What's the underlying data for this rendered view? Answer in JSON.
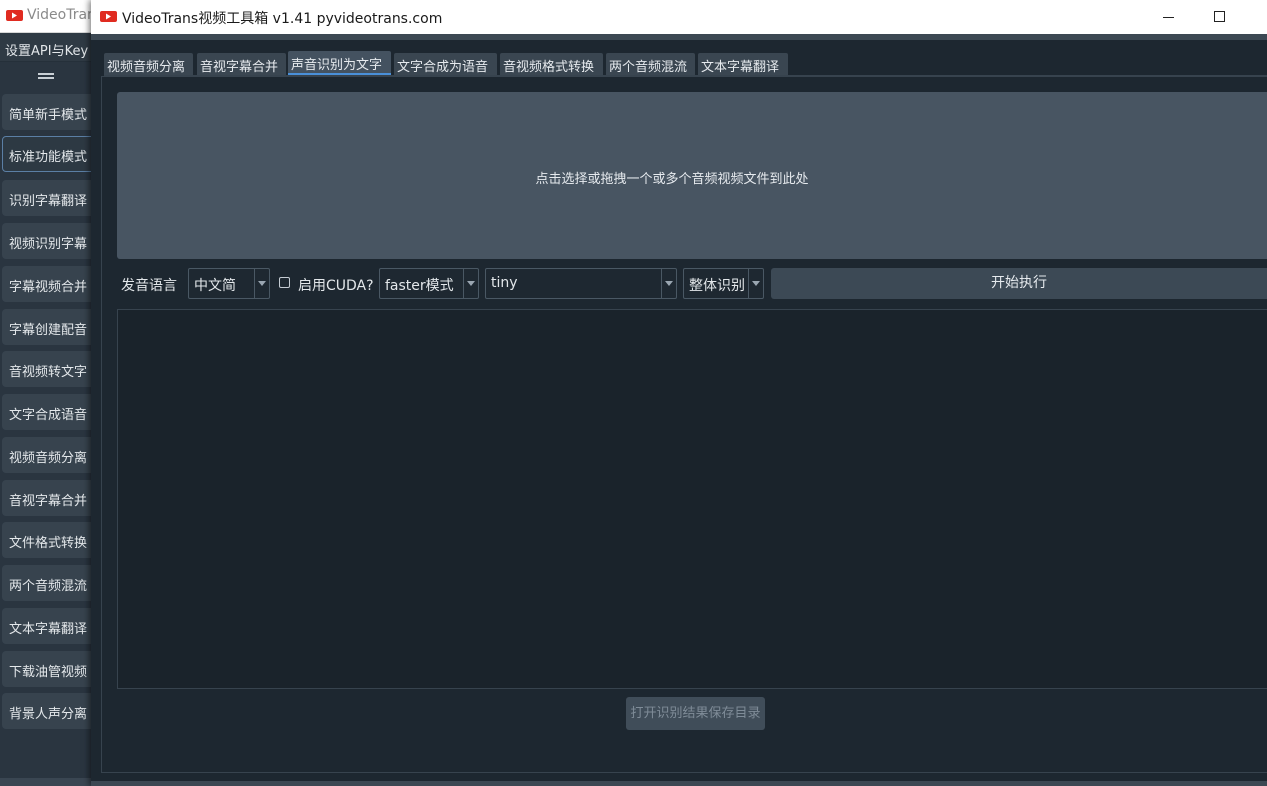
{
  "background_window": {
    "title": "VideoTran",
    "menu": "设置API与Key",
    "sidebar": [
      {
        "label": "简单新手模式"
      },
      {
        "label": "标准功能模式"
      },
      {
        "label": "识别字幕翻译"
      },
      {
        "label": "视频识别字幕"
      },
      {
        "label": "字幕视频合并"
      },
      {
        "label": "字幕创建配音"
      },
      {
        "label": "音视频转文字"
      },
      {
        "label": "文字合成语音"
      },
      {
        "label": "视频音频分离"
      },
      {
        "label": "音视字幕合并"
      },
      {
        "label": "文件格式转换"
      },
      {
        "label": "两个音频混流"
      },
      {
        "label": "文本字幕翻译"
      },
      {
        "label": "下载油管视频"
      },
      {
        "label": "背景人声分离"
      }
    ],
    "active_sidebar": "标准功能模式"
  },
  "window": {
    "title": "VideoTrans视频工具箱 v1.41  pyvideotrans.com"
  },
  "tabs": [
    {
      "label": "视频音频分离"
    },
    {
      "label": "音视字幕合并"
    },
    {
      "label": "声音识别为文字"
    },
    {
      "label": "文字合成为语音"
    },
    {
      "label": "音视频格式转换"
    },
    {
      "label": "两个音频混流"
    },
    {
      "label": "文本字幕翻译"
    }
  ],
  "active_tab": "声音识别为文字",
  "dropzone": {
    "text": "点击选择或拖拽一个或多个音频视频文件到此处"
  },
  "controls": {
    "language_label": "发音语言",
    "language_value": "中文简",
    "cuda_label": "启用CUDA?",
    "cuda_checked": false,
    "mode_value": "faster模式",
    "model_value": "tiny",
    "split_value": "整体识别",
    "start_button": "开始执行"
  },
  "result_text": "",
  "open_dir_button": "打开识别结果保存目录",
  "colors": {
    "accent": "#4a90d9",
    "window_bg": "#1d2730",
    "dropzone_bg": "#485562",
    "logo_red": "#e02b20"
  }
}
